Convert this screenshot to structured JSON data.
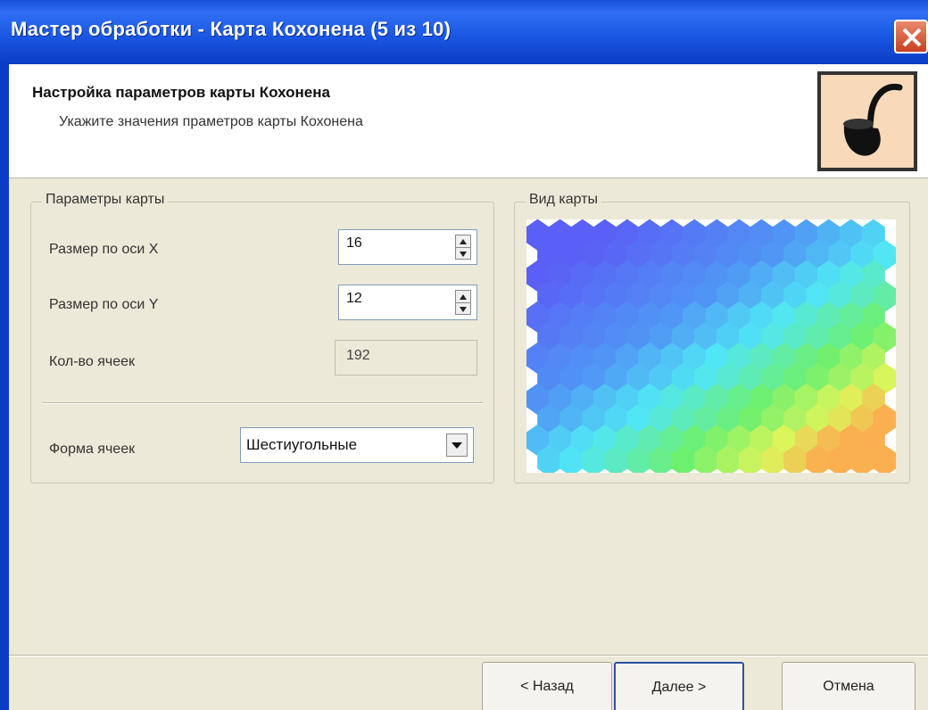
{
  "window": {
    "title": "Мастер обработки - Карта Кохонена (5 из 10)"
  },
  "header": {
    "title": "Настройка параметров карты Кохонена",
    "subtitle": "Укажите значения праметров карты Кохонена",
    "logo_icon": "pipe-icon"
  },
  "params": {
    "legend": "Параметры карты",
    "size_x_label": "Размер по оси X",
    "size_x_value": "16",
    "size_y_label": "Размер по оси Y",
    "size_y_value": "12",
    "cells_label": "Кол-во ячеек",
    "cells_value": "192",
    "shape_label": "Форма ячеек",
    "shape_value": "Шестиугольные"
  },
  "preview": {
    "legend": "Вид карты",
    "grid_cols": 16,
    "grid_rows": 12
  },
  "footer": {
    "back_label": "< Назад",
    "next_label": "Далее >",
    "cancel_label": "Отмена"
  },
  "colors": {
    "titlebar": "#1b58e4",
    "window_bg": "#ece9d8",
    "close": "#c84020"
  }
}
